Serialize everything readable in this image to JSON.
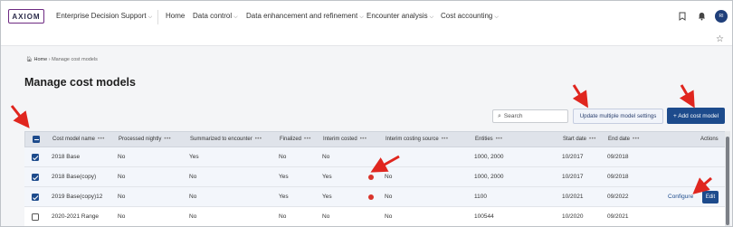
{
  "brand": {
    "logo_text": "AXIOM"
  },
  "nav": {
    "product": "Enterprise Decision Support",
    "items": [
      {
        "label": "Home",
        "has_menu": false
      },
      {
        "label": "Data control",
        "has_menu": true
      },
      {
        "label": "Data enhancement and refinement",
        "has_menu": true
      },
      {
        "label": "Encounter analysis",
        "has_menu": true
      },
      {
        "label": "Cost accounting",
        "has_menu": true
      }
    ],
    "icons": [
      "bookmark-icon",
      "bell-icon"
    ],
    "avatar_initials": "RI"
  },
  "breadcrumb": {
    "home": "Home",
    "current": "Manage cost models",
    "separator": "›"
  },
  "page": {
    "title": "Manage cost models"
  },
  "toolbar": {
    "search_placeholder": "Search",
    "update_label": "Update multiple model settings",
    "add_label": "+ Add cost model"
  },
  "table": {
    "columns": [
      {
        "label": "Cost model name"
      },
      {
        "label": "Processed nightly"
      },
      {
        "label": "Summarized to encounter"
      },
      {
        "label": "Finalized"
      },
      {
        "label": "Interim costed"
      },
      {
        "label": "Interim costing source"
      },
      {
        "label": "Entities"
      },
      {
        "label": "Start date"
      },
      {
        "label": "End date"
      },
      {
        "label": "Actions"
      }
    ],
    "rows": [
      {
        "checked": true,
        "name": "2018 Base",
        "processed": "No",
        "summarized": "Yes",
        "finalized": "No",
        "interim_costed": "No",
        "interim_source": "",
        "entities": "1000, 2000",
        "start": "10/2017",
        "end": "09/2018",
        "warn": false,
        "actions": []
      },
      {
        "checked": true,
        "name": "2018 Base(copy)",
        "processed": "No",
        "summarized": "No",
        "finalized": "Yes",
        "interim_costed": "Yes",
        "interim_source": "No",
        "entities": "1000, 2000",
        "start": "10/2017",
        "end": "09/2018",
        "warn": true,
        "actions": []
      },
      {
        "checked": true,
        "name": "2019 Base(copy)12",
        "processed": "No",
        "summarized": "No",
        "finalized": "Yes",
        "interim_costed": "Yes",
        "interim_source": "No",
        "entities": "1100",
        "start": "10/2021",
        "end": "09/2022",
        "warn": true,
        "actions": [
          "Configure",
          "Edit"
        ]
      },
      {
        "checked": false,
        "name": "2020-2021 Range",
        "processed": "No",
        "summarized": "No",
        "finalized": "No",
        "interim_costed": "No",
        "interim_source": "No",
        "entities": "100544",
        "start": "10/2020",
        "end": "09/2021",
        "warn": false,
        "actions": []
      }
    ]
  },
  "colors": {
    "primary": "#1d4b8c",
    "annotation_arrow": "#e0261f",
    "warning": "#d9342b"
  }
}
